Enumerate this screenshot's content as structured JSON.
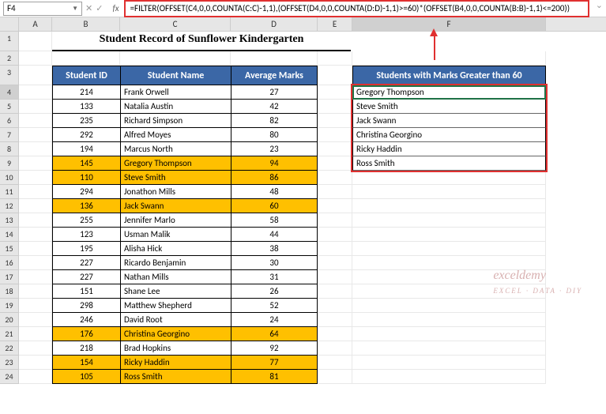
{
  "nameBox": "F4",
  "formula": "=FILTER(OFFSET(C4,0,0,COUNTA(C:C)-1,1),(OFFSET(D4,0,0,COUNTA(D:D)-1,1)>=60)*(OFFSET(B4,0,0,COUNTA(B:B)-1,1)<=200))",
  "fxLabel": "fx",
  "title": "Student Record of Sunflower Kindergarten",
  "columns": [
    "A",
    "B",
    "C",
    "D",
    "E",
    "F"
  ],
  "rowNumbers": [
    "1",
    "2",
    "3",
    "4",
    "5",
    "6",
    "7",
    "8",
    "9",
    "10",
    "11",
    "12",
    "13",
    "14",
    "15",
    "16",
    "17",
    "18",
    "19",
    "20",
    "21",
    "22",
    "23",
    "24"
  ],
  "headers": {
    "id": "Student ID",
    "name": "Student Name",
    "marks": "Average Marks"
  },
  "resultsHeader": "Students with Marks Greater than 60",
  "students": [
    {
      "id": "214",
      "name": "Frank Orwell",
      "marks": "27",
      "hl": false
    },
    {
      "id": "133",
      "name": "Natalia Austin",
      "marks": "42",
      "hl": false
    },
    {
      "id": "235",
      "name": "Richard Simpson",
      "marks": "82",
      "hl": false
    },
    {
      "id": "292",
      "name": "Alfred Moyes",
      "marks": "80",
      "hl": false
    },
    {
      "id": "194",
      "name": "Marcus North",
      "marks": "23",
      "hl": false
    },
    {
      "id": "145",
      "name": "Gregory Thompson",
      "marks": "94",
      "hl": true
    },
    {
      "id": "110",
      "name": "Steve Smith",
      "marks": "86",
      "hl": true
    },
    {
      "id": "294",
      "name": "Jonathon Mills",
      "marks": "48",
      "hl": false
    },
    {
      "id": "136",
      "name": "Jack Swann",
      "marks": "60",
      "hl": true
    },
    {
      "id": "255",
      "name": "Jennifer Marlo",
      "marks": "58",
      "hl": false
    },
    {
      "id": "123",
      "name": "Usman Malik",
      "marks": "44",
      "hl": false
    },
    {
      "id": "195",
      "name": "Alisha Hick",
      "marks": "38",
      "hl": false
    },
    {
      "id": "227",
      "name": "Ricardo Benjamin",
      "marks": "30",
      "hl": false
    },
    {
      "id": "227",
      "name": "Nathan Mills",
      "marks": "31",
      "hl": false
    },
    {
      "id": "151",
      "name": "Shane Lee",
      "marks": "26",
      "hl": false
    },
    {
      "id": "298",
      "name": "Matthew Shepherd",
      "marks": "52",
      "hl": false
    },
    {
      "id": "246",
      "name": "David Root",
      "marks": "24",
      "hl": false
    },
    {
      "id": "176",
      "name": "Christina Georgino",
      "marks": "64",
      "hl": true
    },
    {
      "id": "218",
      "name": "Brad Hopkins",
      "marks": "92",
      "hl": false
    },
    {
      "id": "154",
      "name": "Ricky Haddin",
      "marks": "77",
      "hl": true
    },
    {
      "id": "105",
      "name": "Ross Smith",
      "marks": "81",
      "hl": true
    }
  ],
  "results": [
    "Gregory Thompson",
    "Steve Smith",
    "Jack Swann",
    "Christina Georgino",
    "Ricky Haddin",
    "Ross Smith"
  ],
  "watermark": {
    "main": "exceldemy",
    "sub": "EXCEL · DATA · DIY"
  }
}
